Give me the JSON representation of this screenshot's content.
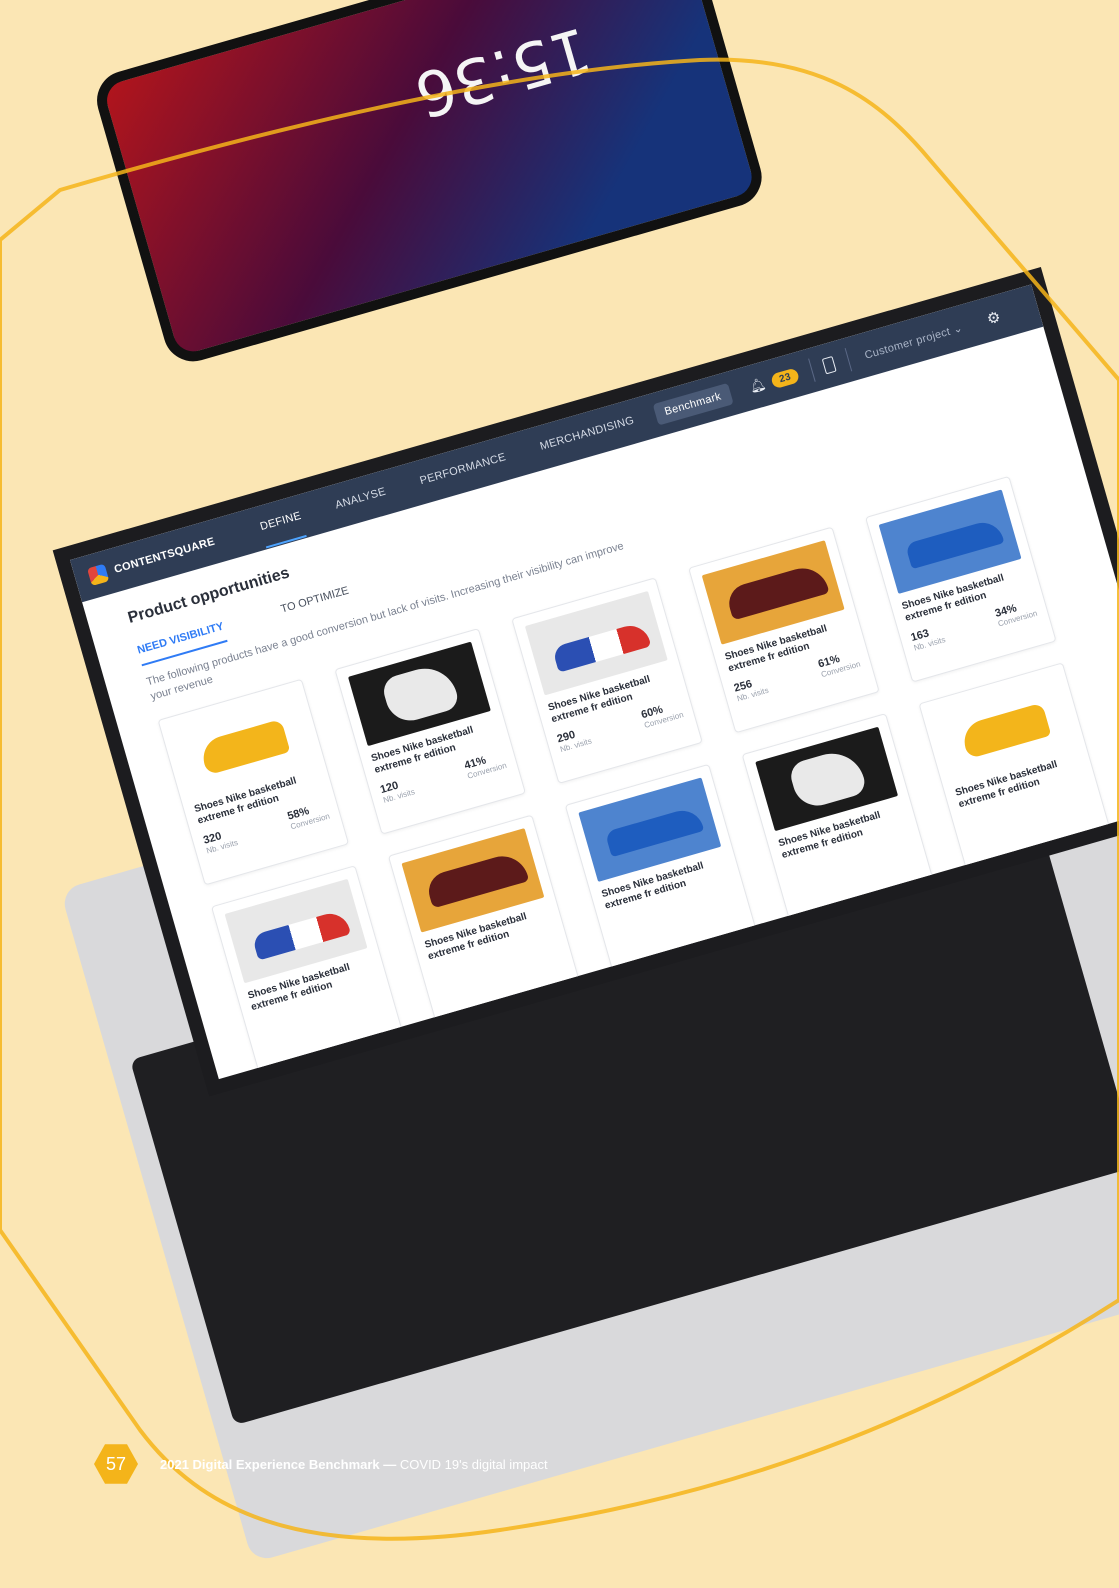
{
  "app": {
    "brand": "CONTENTSQUARE",
    "nav": [
      "DEFINE",
      "ANALYSE",
      "PERFORMANCE",
      "MERCHANDISING"
    ],
    "benchmark_label": "Benchmark",
    "notification_count": "23",
    "project_label": "Customer project"
  },
  "page": {
    "title": "Product opportunities",
    "tabs": [
      "NEED VISIBILITY",
      "TO OPTIMIZE"
    ],
    "description": "The following products have a good conversion but lack of visits. Increasing their visibility can improve your revenue"
  },
  "products": [
    {
      "name": "Shoes Nike basketball extreme fr edition",
      "visits": "320",
      "visits_label": "Nb. visits",
      "conversion": "58%",
      "conversion_label": "Conversion",
      "thumb": "yellow"
    },
    {
      "name": "Shoes Nike basketball extreme fr edition",
      "visits": "120",
      "visits_label": "Nb. visits",
      "conversion": "41%",
      "conversion_label": "Conversion",
      "thumb": "dark"
    },
    {
      "name": "Shoes Nike basketball extreme fr edition",
      "visits": "290",
      "visits_label": "Nb. visits",
      "conversion": "60%",
      "conversion_label": "Conversion",
      "thumb": "white"
    },
    {
      "name": "Shoes Nike basketball extreme fr edition",
      "visits": "256",
      "visits_label": "Nb. visits",
      "conversion": "61%",
      "conversion_label": "Conversion",
      "thumb": "orange"
    },
    {
      "name": "Shoes Nike basketball extreme fr edition",
      "visits": "163",
      "visits_label": "Nb. visits",
      "conversion": "34%",
      "conversion_label": "Conversion",
      "thumb": "blue"
    },
    {
      "name": "Shoes Nike basketball extreme fr edition",
      "thumb": "white"
    },
    {
      "name": "Shoes Nike basketball extreme fr edition",
      "thumb": "orange"
    },
    {
      "name": "Shoes Nike basketball extreme fr edition",
      "thumb": "blue"
    },
    {
      "name": "Shoes Nike basketball extreme fr edition",
      "thumb": "dark"
    },
    {
      "name": "Shoes Nike basketball extreme fr edition",
      "thumb": "yellow"
    }
  ],
  "phone": {
    "time": "15:36"
  },
  "footer": {
    "page_number": "57",
    "title_bold": "2021 Digital Experience Benchmark —",
    "title_rest": " COVID 19's digital impact"
  },
  "colors": {
    "background": "#fbe6b4",
    "accent": "#f4b41a",
    "nav_bg": "#2f3d55",
    "link_blue": "#2f7bf5"
  }
}
